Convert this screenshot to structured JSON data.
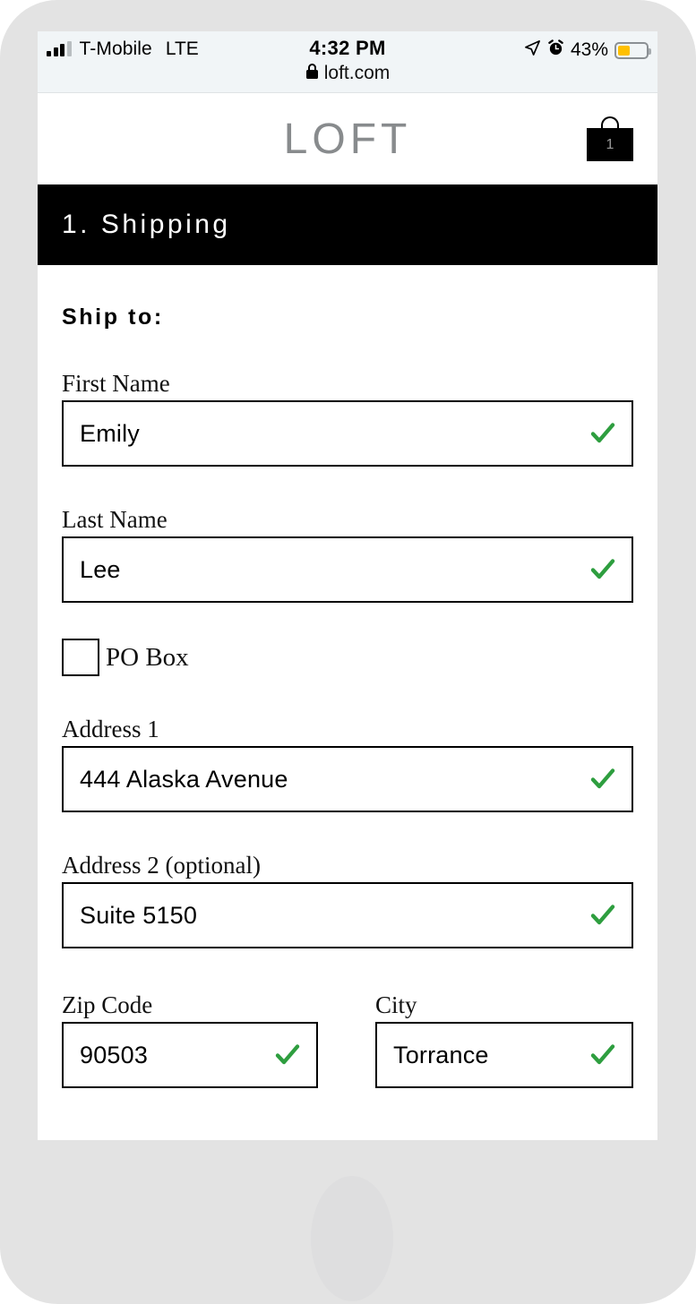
{
  "status_bar": {
    "signal_icon": "signal-bars-icon",
    "carrier": "T-Mobile",
    "network": "LTE",
    "time": "4:32 PM",
    "lock_icon": "lock-icon",
    "url": "loft.com",
    "location_icon": "location-arrow-icon",
    "alarm_icon": "alarm-clock-icon",
    "battery_percent": "43%",
    "battery_color": "#ffc000"
  },
  "header": {
    "brand": "LOFT",
    "brand_color": "#888b8d",
    "bag_icon": "shopping-bag-icon",
    "bag_count": "1"
  },
  "step": {
    "title": "1. Shipping",
    "background": "#000000"
  },
  "form": {
    "heading": "Ship to:",
    "check_color": "#2e9e3f",
    "fields": [
      {
        "name": "first-name",
        "label": "First Name",
        "value": "Emily",
        "placeholder": "First Name",
        "valid": true
      },
      {
        "name": "last-name",
        "label": "Last Name",
        "value": "Lee",
        "placeholder": "Last Name",
        "valid": true
      },
      {
        "name": "address-1",
        "label": "Address 1",
        "value": "444 Alaska Avenue",
        "placeholder": "Address 1",
        "valid": true
      },
      {
        "name": "address-2",
        "label": "Address 2 (optional)",
        "value": "Suite 5150",
        "placeholder": "Address 2 (optional)",
        "valid": true
      },
      {
        "name": "zip-code",
        "label": "Zip Code",
        "value": "90503",
        "placeholder": "Zip Code",
        "valid": true
      },
      {
        "name": "city",
        "label": "City",
        "value": "Torrance",
        "placeholder": "City",
        "valid": true
      }
    ],
    "po_box": {
      "label": "PO Box",
      "checked": false
    }
  }
}
